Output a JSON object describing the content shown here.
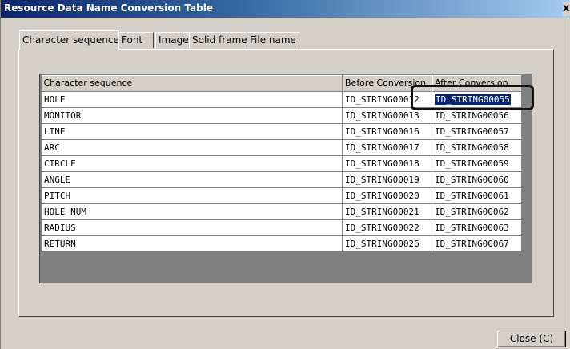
{
  "window": {
    "title": "Resource Data Name Conversion Table",
    "close_glyph": "x"
  },
  "tabs": [
    {
      "label": "Character sequence",
      "active": true
    },
    {
      "label": "Font",
      "active": false
    },
    {
      "label": "Image",
      "active": false
    },
    {
      "label": "Solid frame",
      "active": false
    },
    {
      "label": "File name",
      "active": false
    }
  ],
  "table": {
    "columns": [
      "Character sequence",
      "Before Conversion",
      "After Conversion"
    ],
    "rows": [
      [
        "HOLE",
        "ID_STRING00012",
        "ID_STRING00055"
      ],
      [
        "MONITOR",
        "ID_STRING00013",
        "ID_STRING00056"
      ],
      [
        "LINE",
        "ID_STRING00016",
        "ID_STRING00057"
      ],
      [
        "ARC",
        "ID_STRING00017",
        "ID_STRING00058"
      ],
      [
        "CIRCLE",
        "ID_STRING00018",
        "ID_STRING00059"
      ],
      [
        "ANGLE",
        "ID_STRING00019",
        "ID_STRING00060"
      ],
      [
        "PITCH",
        "ID_STRING00020",
        "ID_STRING00061"
      ],
      [
        "HOLE NUM",
        "ID_STRING00021",
        "ID_STRING00062"
      ],
      [
        "RADIUS",
        "ID_STRING00022",
        "ID_STRING00063"
      ],
      [
        "RETURN",
        "ID_STRING00026",
        "ID_STRING00067"
      ]
    ],
    "selected_cell": {
      "row": 0,
      "col": 2
    }
  },
  "buttons": {
    "close_label": "Close (C)"
  },
  "colors": {
    "titlebar_start": "#0a246a",
    "titlebar_end": "#a6caf0",
    "face": "#d4d0c8",
    "selection": "#0a246a",
    "annotation_box": "#111111"
  }
}
